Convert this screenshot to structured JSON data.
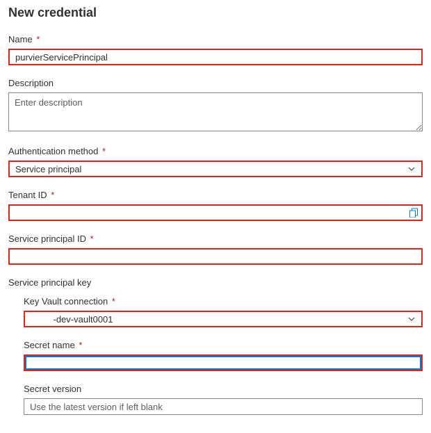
{
  "title": "New credential",
  "fields": {
    "name": {
      "label": "Name",
      "value": "purvierServicePrincipal"
    },
    "description": {
      "label": "Description",
      "placeholder": "Enter description",
      "value": ""
    },
    "authMethod": {
      "label": "Authentication method",
      "selected": "Service principal"
    },
    "tenantId": {
      "label": "Tenant ID",
      "value": ""
    },
    "spId": {
      "label": "Service principal ID",
      "value": ""
    },
    "spKey": {
      "label": "Service principal key"
    },
    "keyVault": {
      "label": "Key Vault connection",
      "selected": "         -dev-vault0001"
    },
    "secretName": {
      "label": "Secret name",
      "value": ""
    },
    "secretVersion": {
      "label": "Secret version",
      "placeholder": "Use the latest version if left blank",
      "value": ""
    }
  },
  "requiredMark": "*"
}
